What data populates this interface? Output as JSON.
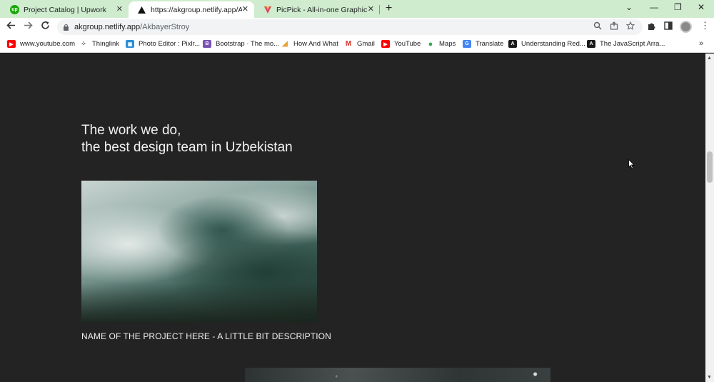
{
  "browser": {
    "tabs": [
      {
        "title": "Project Catalog | Upwork",
        "icon": "upwork-icon",
        "color": "#14a800"
      },
      {
        "title": "https://akgroup.netlify.app/Akbaye",
        "icon": "site-triangle-icon",
        "color": "#000000"
      },
      {
        "title": "PicPick - All-in-one Graphic Desi",
        "icon": "picpick-icon",
        "color": "#e0455b"
      }
    ],
    "close_glyph": "✕",
    "new_tab_glyph": "+",
    "window": {
      "tablist": "⌄",
      "minimize": "—",
      "restore": "❐",
      "close": "✕"
    },
    "url_host": "akgroup.netlify.app",
    "url_path": "/AkbayerStroy",
    "bookmarks": [
      {
        "label": "www.youtube.com",
        "icon": "youtube-icon",
        "color": "#ff0000"
      },
      {
        "label": "Thinglink",
        "icon": "thinglink-icon",
        "color": "#333333"
      },
      {
        "label": "Photo Editor : Pixlr...",
        "icon": "pixlr-icon",
        "color": "#2b8fd6"
      },
      {
        "label": "Bootstrap · The mo...",
        "icon": "bootstrap-icon",
        "color": "#7952b3"
      },
      {
        "label": "How And What",
        "icon": "howandwhat-icon",
        "color": "#e8a23a"
      },
      {
        "label": "Gmail",
        "icon": "gmail-icon",
        "color": "#d93025"
      },
      {
        "label": "YouTube",
        "icon": "youtube-icon",
        "color": "#ff0000"
      },
      {
        "label": "Maps",
        "icon": "maps-icon",
        "color": "#34a853"
      },
      {
        "label": "Translate",
        "icon": "translate-icon",
        "color": "#4285f4"
      },
      {
        "label": "Understanding Red...",
        "icon": "article-icon",
        "color": "#1a1a1a"
      },
      {
        "label": "The JavaScript Arra...",
        "icon": "article-icon",
        "color": "#1a1a1a"
      }
    ],
    "bookmarks_more": "»"
  },
  "page": {
    "heading_line1": "The work we do,",
    "heading_line2": "the best design team in Uzbekistan",
    "project_caption": "NAME OF THE PROJECT HERE - A LITTLE BIT DESCRIPTION",
    "background_color": "#232323"
  }
}
